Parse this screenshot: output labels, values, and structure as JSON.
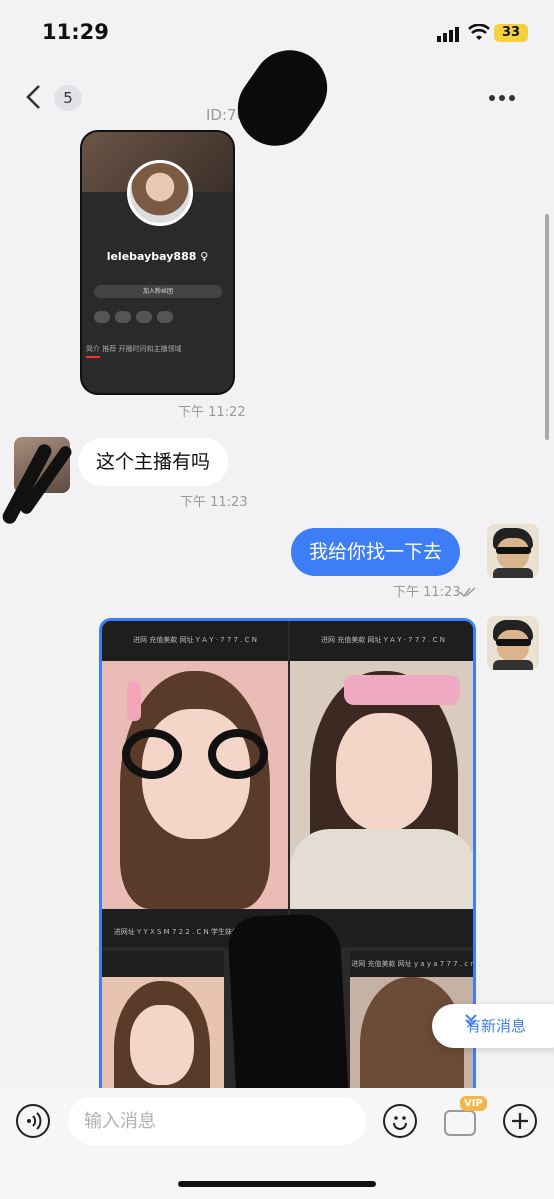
{
  "status": {
    "time": "11:29",
    "battery": "33"
  },
  "header": {
    "back_icon": "chevron-left-icon",
    "unread_count": "5",
    "subtitle": "ID:70   • 在线",
    "more_icon": "more-horizontal-icon"
  },
  "messages": {
    "shot": {
      "username": "lelebaybay888 ♀",
      "pill": "加入粉丝团",
      "tabs": "简介  推荐  开播时间和主播领域",
      "time": "下午 11:22"
    },
    "incoming": {
      "text": "这个主播有吗",
      "time": "下午 11:23"
    },
    "outgoing": {
      "text": "我给你找一下去",
      "time": "下午 11:23",
      "read_icon": "double-check-icon"
    },
    "grid": {
      "cap_top_left": "进网  充值美款  网址 Y A Y · 7 7 7 . C N",
      "cap_top_right": "进网  充值美款  网址 Y A Y · 7 7 7 . C N",
      "cap_mid": "进网址 Y Y X S M 7 2 2 . C N   学生妹线上玩  线下约",
      "cap_bottom": "进网 充值美款 网址 y a y a 7 7 7 . c n"
    }
  },
  "new_message": {
    "label": "有新消息",
    "icon": "double-chevron-down-icon"
  },
  "composer": {
    "placeholder": "输入消息",
    "vip_label": "VIP"
  }
}
